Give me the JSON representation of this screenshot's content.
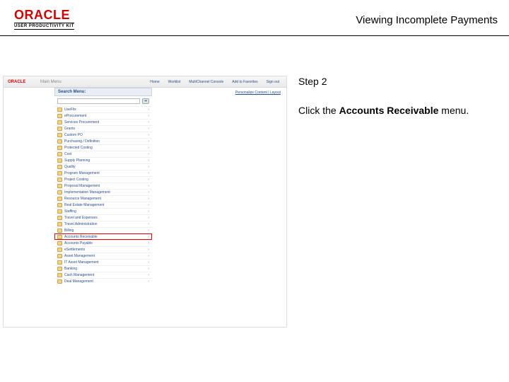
{
  "header": {
    "logo_text": "ORACLE",
    "logo_subtext": "USER PRODUCTIVITY KIT",
    "page_title": "Viewing Incomplete Payments"
  },
  "instruction": {
    "step_label": "Step 2",
    "text_before": "Click the ",
    "bold_text": "Accounts Receivable",
    "text_after": " menu."
  },
  "thumb": {
    "oracle_mini": "ORACLE",
    "main_menu_label": "Main Menu",
    "top_links": {
      "home": "Home",
      "worklist": "Worklist",
      "multichannel": "MultiChannel Console",
      "favorites": "Add to Favorites",
      "signout": "Sign out"
    },
    "menu_header": "Search Menu:",
    "search_placeholder": "",
    "go_glyph": "➔",
    "personalize_link": "Personalize Content | Layout",
    "menu_items": [
      {
        "label": "UseFlix",
        "h": false
      },
      {
        "label": "eProcurement",
        "h": false
      },
      {
        "label": "Services Procurement",
        "h": false
      },
      {
        "label": "Grants",
        "h": false
      },
      {
        "label": "Custom PO",
        "h": false
      },
      {
        "label": "Purchasing / Definition",
        "h": false
      },
      {
        "label": "Protected Costing",
        "h": false
      },
      {
        "label": "Cost",
        "h": false
      },
      {
        "label": "Supply Planning",
        "h": false
      },
      {
        "label": "Quality",
        "h": false
      },
      {
        "label": "Program Management",
        "h": false
      },
      {
        "label": "Project Costing",
        "h": false
      },
      {
        "label": "Proposal Management",
        "h": false
      },
      {
        "label": "Implementation Management",
        "h": false
      },
      {
        "label": "Resource Management",
        "h": false
      },
      {
        "label": "Real Estate Management",
        "h": false
      },
      {
        "label": "Staffing",
        "h": false
      },
      {
        "label": "Travel and Expenses",
        "h": false
      },
      {
        "label": "Travel Administration",
        "h": false
      },
      {
        "label": "Billing",
        "h": false
      },
      {
        "label": "Accounts Receivable",
        "h": true
      },
      {
        "label": "Accounts Payable",
        "h": false
      },
      {
        "label": "eSettlements",
        "h": false
      },
      {
        "label": "Asset Management",
        "h": false
      },
      {
        "label": "IT Asset Management",
        "h": false
      },
      {
        "label": "Banking",
        "h": false
      },
      {
        "label": "Cash Management",
        "h": false
      },
      {
        "label": "Deal Management",
        "h": false
      }
    ]
  }
}
